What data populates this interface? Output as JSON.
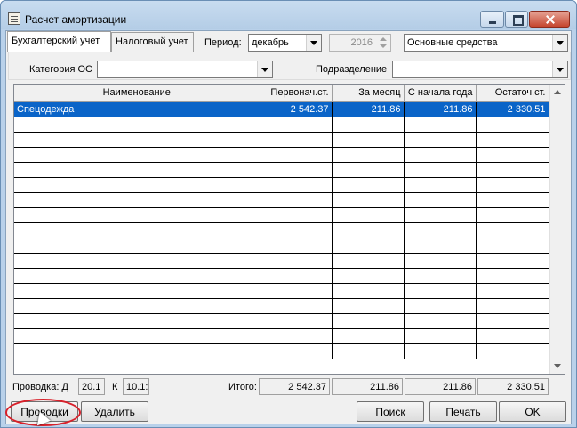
{
  "window": {
    "title": "Расчет амортизации"
  },
  "tabs": [
    {
      "label": "Бухгалтерский учет",
      "active": true
    },
    {
      "label": "Налоговый учет",
      "active": false
    }
  ],
  "period": {
    "label": "Период:",
    "month": "декабрь",
    "year": "2016"
  },
  "asset_type": {
    "value": "Основные средства"
  },
  "filters": {
    "category_label": "Категория ОС",
    "category_value": "",
    "division_label": "Подразделение",
    "division_value": ""
  },
  "table": {
    "columns": [
      "Наименование",
      "Первонач.ст.",
      "За месяц",
      "С начала года",
      "Остаточ.ст."
    ],
    "rows": [
      [
        "Спецодежда",
        "2 542.37",
        "211.86",
        "211.86",
        "2 330.51"
      ]
    ]
  },
  "footer": {
    "posting_label": "Проводка: Д",
    "debit": "20.1",
    "credit_label": "К",
    "credit": "10.1:",
    "total_label": "Итого:",
    "totals": [
      "2 542.37",
      "211.86",
      "211.86",
      "2 330.51"
    ]
  },
  "buttons": {
    "postings": "Проводки",
    "delete": "Удалить",
    "search": "Поиск",
    "print": "Печать",
    "ok": "OK"
  },
  "colors": {
    "selection": "#0a64c8",
    "highlight_ring": "#d8202a"
  }
}
